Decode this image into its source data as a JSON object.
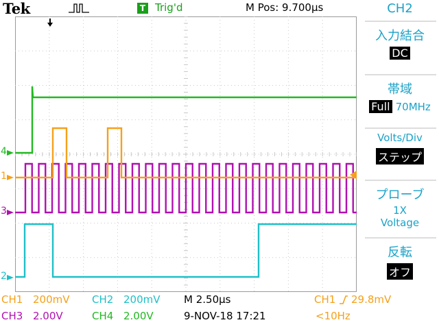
{
  "header": {
    "brand": "Tek",
    "acquisition_icon": "pulse-acquisition-icon",
    "trigger_badge": "T",
    "trigger_status": "Trig'd",
    "m_pos": "M Pos: 9.700µs"
  },
  "menu": {
    "channel": "CH2",
    "coupling": {
      "title": "入力結合",
      "value": "DC"
    },
    "bandwidth": {
      "title": "帯域",
      "value_inverted": "Full",
      "value": "70MHz"
    },
    "volts_div": {
      "title": "Volts/Div",
      "value": "ステップ"
    },
    "probe": {
      "title": "プローブ",
      "value1": "1X",
      "value2": "Voltage"
    },
    "invert": {
      "title": "反転",
      "value": "オフ"
    }
  },
  "markers": {
    "ch4": "4",
    "ch1": "1",
    "ch3": "3",
    "ch2": "2"
  },
  "readouts": {
    "ch1_label": "CH1",
    "ch1_scale": "200mV",
    "ch2_label": "CH2",
    "ch2_scale": "200mV",
    "ch3_label": "CH3",
    "ch3_scale": "2.00V",
    "ch4_label": "CH4",
    "ch4_scale": "2.00V",
    "timebase": "M 2.50µs",
    "date_time": "9-NOV-18 17:21",
    "trigger_source": "CH1",
    "trigger_level": "29.8mV",
    "trigger_freq": "<10Hz"
  },
  "colors": {
    "ch1": "#f5a01a",
    "ch2": "#1ec0c8",
    "ch3": "#b010b0",
    "ch4": "#22b822",
    "menu_text": "#1aa2c8",
    "grid": "#c8c8c8"
  }
}
